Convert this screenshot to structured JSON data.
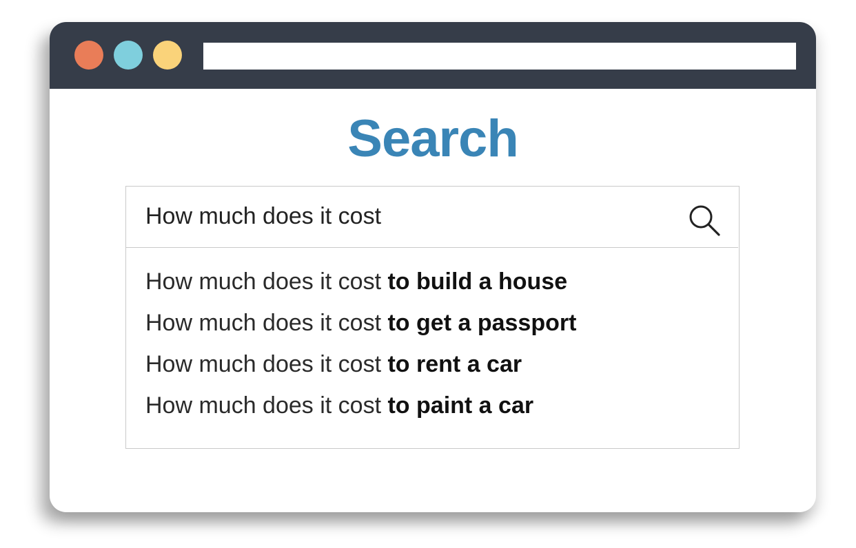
{
  "colors": {
    "titlebar": "#363d49",
    "dot_red": "#e97d58",
    "dot_blue": "#7fcfdd",
    "dot_yellow": "#fad37a",
    "title": "#3a85b6",
    "border": "#c9c9c9"
  },
  "window": {
    "controls": [
      {
        "name": "close",
        "color": "#e97d58"
      },
      {
        "name": "minimize",
        "color": "#7fcfdd"
      },
      {
        "name": "maximize",
        "color": "#fad37a"
      }
    ],
    "address_bar_value": ""
  },
  "page": {
    "title": "Search"
  },
  "search": {
    "value": "How much does it cost",
    "icon": "search-icon",
    "suggestions": [
      {
        "prefix": "How much does it cost",
        "completion": "to build a house"
      },
      {
        "prefix": "How much does it cost",
        "completion": "to get a passport"
      },
      {
        "prefix": "How much does it cost",
        "completion": "to rent a car"
      },
      {
        "prefix": "How much does it cost",
        "completion": "to paint a car"
      }
    ]
  }
}
